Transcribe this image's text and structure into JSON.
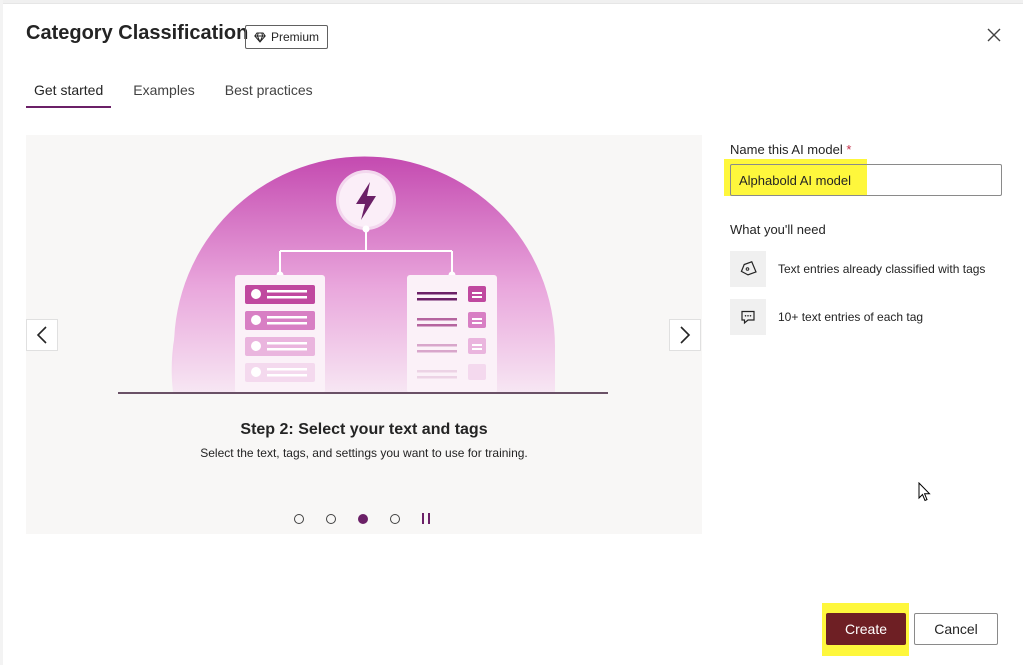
{
  "dialog": {
    "title": "Category Classification",
    "premium_badge": "Premium",
    "close_icon": "close-icon"
  },
  "tabs": [
    {
      "label": "Get started",
      "active": true
    },
    {
      "label": "Examples",
      "active": false
    },
    {
      "label": "Best practices",
      "active": false
    }
  ],
  "carousel": {
    "step_title": "Step 2: Select your text and tags",
    "step_description": "Select the text, tags, and settings you want to use for training.",
    "slide_count": 4,
    "active_slide": 3,
    "accent_color": "#6b2067"
  },
  "form": {
    "name_label": "Name this AI model",
    "required_marker": "*",
    "name_value": "Alphabold AI model"
  },
  "requirements": {
    "title": "What you'll need",
    "items": [
      {
        "icon": "tag-icon",
        "text": "Text entries already classified with tags"
      },
      {
        "icon": "comment-icon",
        "text": "10+ text entries of each tag"
      }
    ]
  },
  "footer": {
    "create_label": "Create",
    "cancel_label": "Cancel",
    "create_color": "#6e1f24",
    "highlight_color": "#fef73c"
  }
}
